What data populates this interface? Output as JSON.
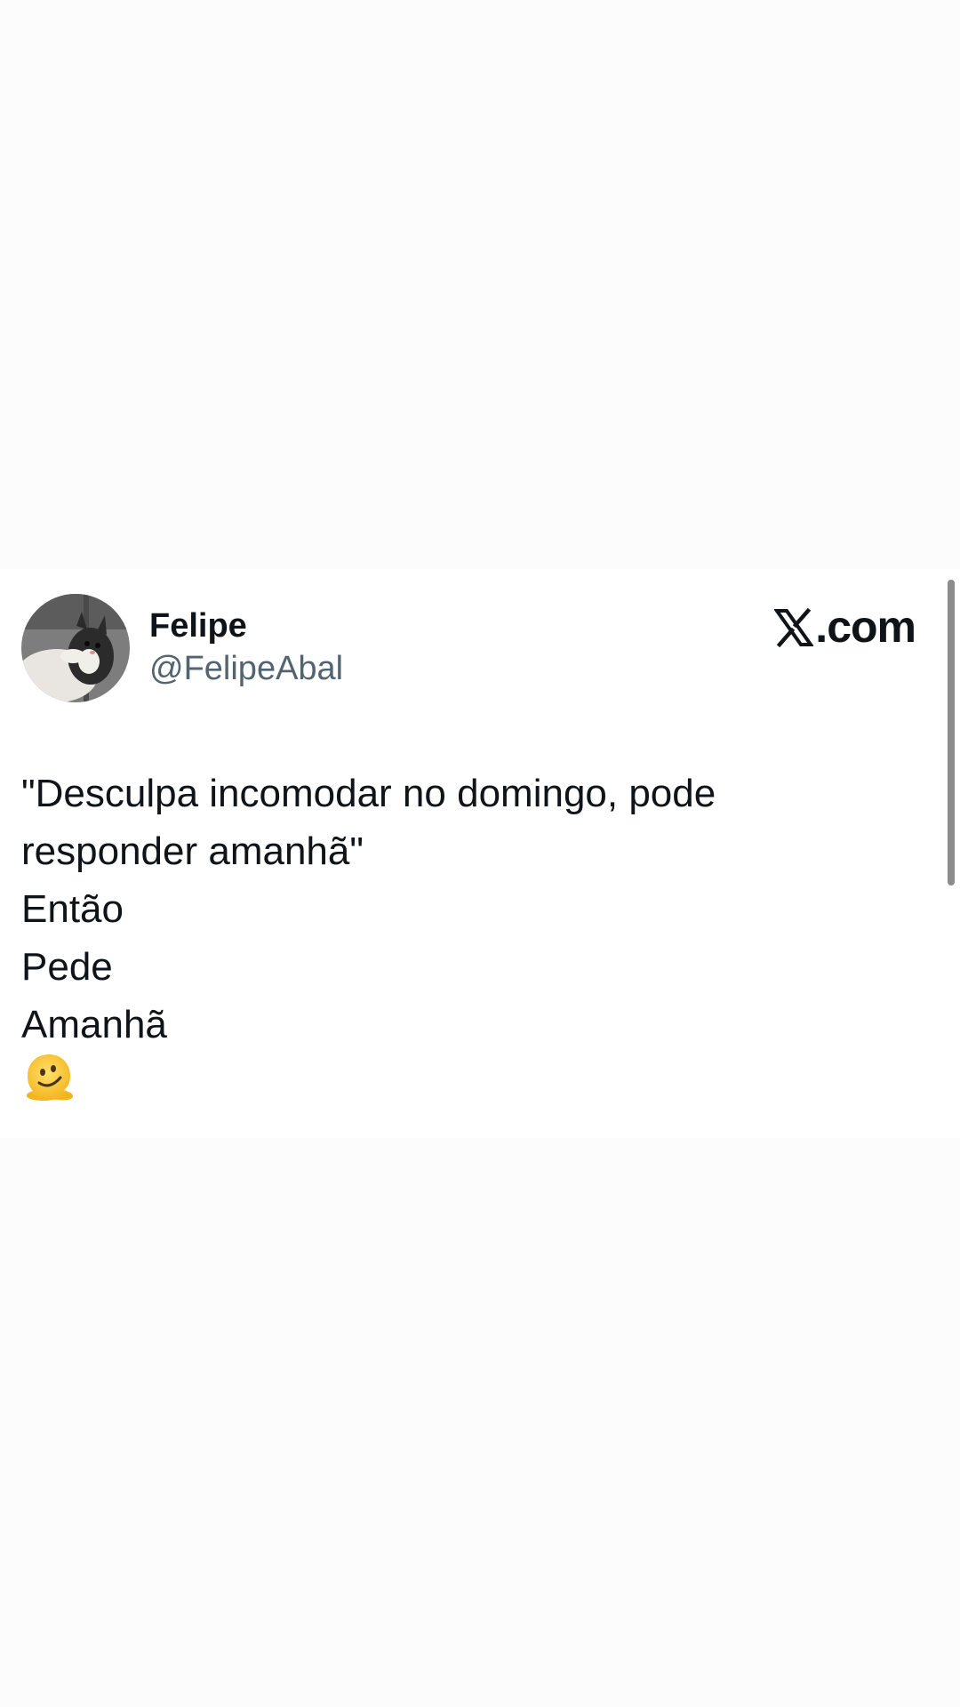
{
  "tweet": {
    "author": {
      "display_name": "Felipe",
      "handle": "@FelipeAbal",
      "avatar_icon": "cat-avatar"
    },
    "brand": {
      "icon": "x-logo-icon",
      "label": ".com"
    },
    "text_lines": [
      "\"Desculpa incomodar no domingo, pode",
      "responder amanhã\"",
      "Então",
      "Pede",
      "Amanhã"
    ],
    "emoji": "melting-face-emoji"
  },
  "colors": {
    "name": "#0f1419",
    "handle": "#536471",
    "emoji": "#f7c538"
  }
}
